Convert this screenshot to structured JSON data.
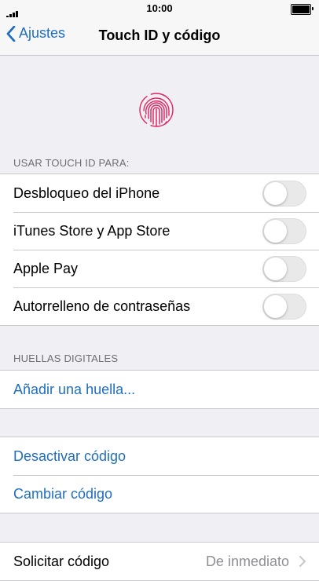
{
  "status_bar": {
    "time": "10:00"
  },
  "nav": {
    "back_label": "Ajustes",
    "title": "Touch ID y código"
  },
  "touch_id_section": {
    "header": "USAR TOUCH ID PARA:",
    "items": [
      {
        "label": "Desbloqueo del iPhone",
        "on": false
      },
      {
        "label": "iTunes Store y App Store",
        "on": false
      },
      {
        "label": "Apple Pay",
        "on": false
      },
      {
        "label": "Autorrelleno de contraseñas",
        "on": false
      }
    ]
  },
  "fingerprints_section": {
    "header": "HUELLAS DIGITALES",
    "add_label": "Añadir una huella..."
  },
  "passcode_section": {
    "disable_label": "Desactivar código",
    "change_label": "Cambiar código"
  },
  "require_section": {
    "label": "Solicitar código",
    "value": "De inmediato"
  },
  "colors": {
    "accent": "#1f6ebf",
    "fingerprint": "#e0245e"
  }
}
